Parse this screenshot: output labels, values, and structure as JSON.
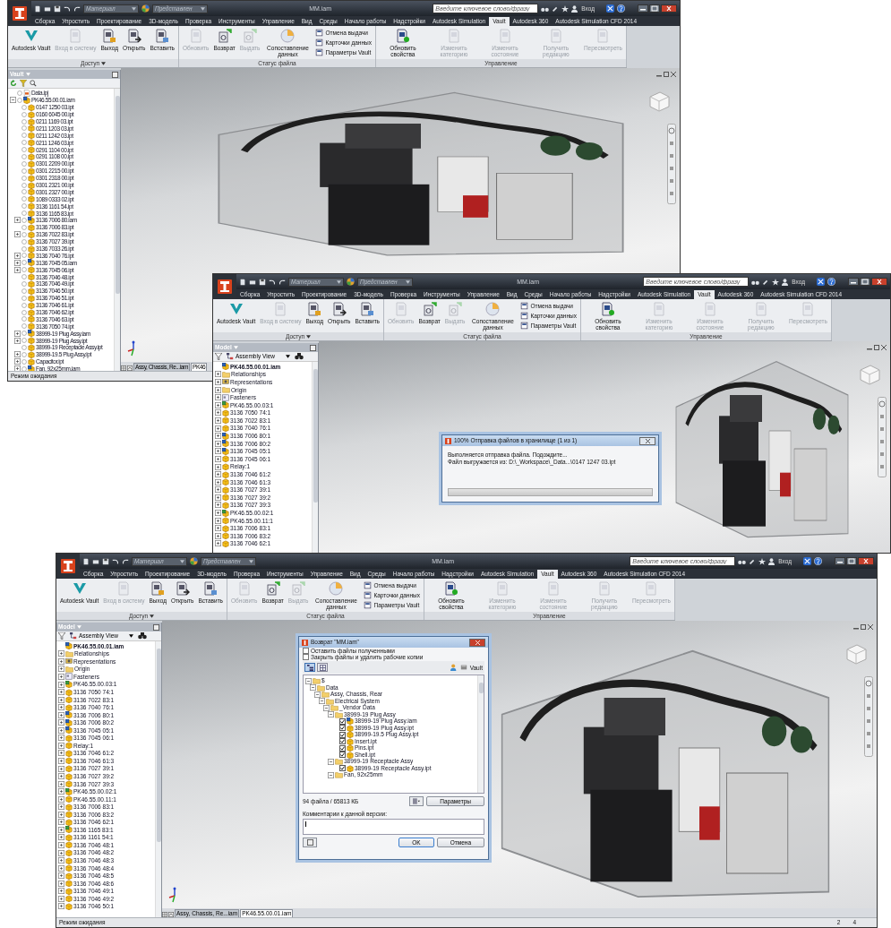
{
  "windows": [
    {
      "title": "MM.iam",
      "material": "Материал",
      "appearance": "Представлен",
      "search": {
        "placeholder": "Введите ключевое слово/фразу"
      },
      "sign_in": "Вход",
      "tabs": [
        {
          "label": "Сборка",
          "selected": false
        },
        {
          "label": "Упростить",
          "selected": false
        },
        {
          "label": "Проектирование",
          "selected": false
        },
        {
          "label": "3D-модель",
          "selected": false
        },
        {
          "label": "Проверка",
          "selected": false
        },
        {
          "label": "Инструменты",
          "selected": false
        },
        {
          "label": "Управление",
          "selected": false
        },
        {
          "label": "Вид",
          "selected": false
        },
        {
          "label": "Среды",
          "selected": false
        },
        {
          "label": "Начало работы",
          "selected": false
        },
        {
          "label": "Надстройки",
          "selected": false
        },
        {
          "label": "Autodesk Simulation",
          "selected": false
        },
        {
          "label": "Vault",
          "selected": true
        },
        {
          "label": "Autodesk 360",
          "selected": false
        },
        {
          "label": "Autodesk Simulation CFD 2014",
          "selected": false
        }
      ],
      "ribbon": [
        {
          "label": "Доступ",
          "buttons": [
            {
              "label": "Autodesk Vault",
              "kind": "large",
              "disabled": false
            },
            {
              "label": "Вход в систему",
              "kind": "large",
              "disabled": true
            },
            {
              "label": "Выход",
              "kind": "large",
              "disabled": false
            },
            {
              "label": "Открыть",
              "kind": "large",
              "disabled": false
            },
            {
              "label": "Вставить",
              "kind": "large",
              "disabled": false
            }
          ]
        },
        {
          "label": "Статус файла",
          "buttons": [
            {
              "label": "Обновить",
              "kind": "large",
              "disabled": true
            },
            {
              "label": "Возврат",
              "kind": "large",
              "disabled": false
            },
            {
              "label": "Выдать",
              "kind": "large",
              "disabled": true
            },
            {
              "label": "Сопоставление данных",
              "kind": "large",
              "disabled": false
            },
            {
              "label": "Отмена выдачи",
              "kind": "small",
              "disabled": false
            },
            {
              "label": "Карточки данных",
              "kind": "small",
              "disabled": false
            },
            {
              "label": "Параметры Vault",
              "kind": "small",
              "disabled": false
            }
          ]
        },
        {
          "label": "Управление",
          "buttons": [
            {
              "label": "Обновить свойства",
              "kind": "large",
              "disabled": false
            },
            {
              "label": "Изменить категорию",
              "kind": "large",
              "disabled": true
            },
            {
              "label": "Изменить состояние",
              "kind": "large",
              "disabled": true
            },
            {
              "label": "Получить редакцию",
              "kind": "large",
              "disabled": true
            },
            {
              "label": "Пересмотреть",
              "kind": "large",
              "disabled": true
            }
          ]
        }
      ],
      "browser": {
        "kind": "vault",
        "title": "Vault",
        "tree": [
          {
            "label": "Data.ipj",
            "kind": "project"
          },
          {
            "label": "PK46.55.00.01.iam",
            "kind": "assembly",
            "expanded": true,
            "children": [
              {
                "label": "0147 1250 03.ipt",
                "kind": "part"
              },
              {
                "label": "0160 6045 00.ipt",
                "kind": "part"
              },
              {
                "label": "0211 1169 03.ipt",
                "kind": "part"
              },
              {
                "label": "0211 1203 03.ipt",
                "kind": "part"
              },
              {
                "label": "0211 1242 03.ipt",
                "kind": "part"
              },
              {
                "label": "0211 1246 03.ipt",
                "kind": "part"
              },
              {
                "label": "0291 1104 00.ipt",
                "kind": "part"
              },
              {
                "label": "0291 1108 00.ipt",
                "kind": "part"
              },
              {
                "label": "0301 2209 00.ipt",
                "kind": "part"
              },
              {
                "label": "0301 2215 00.ipt",
                "kind": "part"
              },
              {
                "label": "0301 2318 00.ipt",
                "kind": "part"
              },
              {
                "label": "0301 2321 00.ipt",
                "kind": "part"
              },
              {
                "label": "0301 2327 00.ipt",
                "kind": "part"
              },
              {
                "label": "1089 0333 02.ipt",
                "kind": "part"
              },
              {
                "label": "3136 1161 54.ipt",
                "kind": "part"
              },
              {
                "label": "3136 1165 83.ipt",
                "kind": "part"
              },
              {
                "label": "3136 7006 80.iam",
                "kind": "assembly",
                "expanded": false
              },
              {
                "label": "3136 7006 83.ipt",
                "kind": "part"
              },
              {
                "label": "3136 7022 83.ipt",
                "kind": "part",
                "expanded": false
              },
              {
                "label": "3136 7027 39.ipt",
                "kind": "part"
              },
              {
                "label": "3136 7033 26.ipt",
                "kind": "part"
              },
              {
                "label": "3136 7040 76.ipt",
                "kind": "part",
                "expanded": false
              },
              {
                "label": "3136 7045 05.iam",
                "kind": "assembly",
                "expanded": false
              },
              {
                "label": "3136 7045 06.ipt",
                "kind": "part",
                "expanded": false
              },
              {
                "label": "3136 7046 48.ipt",
                "kind": "part"
              },
              {
                "label": "3136 7046 49.ipt",
                "kind": "part"
              },
              {
                "label": "3136 7046 50.ipt",
                "kind": "part"
              },
              {
                "label": "3136 7046 51.ipt",
                "kind": "part"
              },
              {
                "label": "3136 7046 61.ipt",
                "kind": "part"
              },
              {
                "label": "3136 7046 62.ipt",
                "kind": "part"
              },
              {
                "label": "3136 7046 63.ipt",
                "kind": "part"
              },
              {
                "label": "3136 7050 74.ipt",
                "kind": "part"
              },
              {
                "label": "38999-19 Plug Assy.iam",
                "kind": "assembly",
                "expanded": false
              },
              {
                "label": "38999-19 Plug Assy.ipt",
                "kind": "part",
                "expanded": false
              },
              {
                "label": "38999-19 Receptacle Assy.ipt",
                "kind": "part"
              },
              {
                "label": "38999-19.5 Plug Assy.ipt",
                "kind": "part",
                "expanded": false
              },
              {
                "label": "Capacitor.ipt",
                "kind": "part",
                "expanded": false
              },
              {
                "label": "Fan, 92x25mm.iam",
                "kind": "assembly",
                "expanded": false
              }
            ]
          }
        ]
      },
      "document_tabs": [
        {
          "label": "Assy, Chassis, Re...iam",
          "selected": false
        },
        {
          "label": "PK46",
          "selected": true
        }
      ],
      "status_bar": {
        "text": "Режим ожидания"
      }
    },
    {
      "title": "MM.iam",
      "material": "Материал",
      "appearance": "Представлен",
      "search": {
        "placeholder": "Введите ключевое слово/фразу"
      },
      "sign_in": "Вход",
      "tabs": [
        {
          "label": "Сборка",
          "selected": false
        },
        {
          "label": "Упростить",
          "selected": false
        },
        {
          "label": "Проектирование",
          "selected": false
        },
        {
          "label": "3D-модель",
          "selected": false
        },
        {
          "label": "Проверка",
          "selected": false
        },
        {
          "label": "Инструменты",
          "selected": false
        },
        {
          "label": "Управление",
          "selected": false
        },
        {
          "label": "Вид",
          "selected": false
        },
        {
          "label": "Среды",
          "selected": false
        },
        {
          "label": "Начало работы",
          "selected": false
        },
        {
          "label": "Надстройки",
          "selected": false
        },
        {
          "label": "Autodesk Simulation",
          "selected": false
        },
        {
          "label": "Vault",
          "selected": true
        },
        {
          "label": "Autodesk 360",
          "selected": false
        },
        {
          "label": "Autodesk Simulation CFD 2014",
          "selected": false
        }
      ],
      "ribbon": [
        {
          "label": "Доступ",
          "buttons": [
            {
              "label": "Autodesk Vault",
              "kind": "large",
              "disabled": false
            },
            {
              "label": "Вход в систему",
              "kind": "large",
              "disabled": true
            },
            {
              "label": "Выход",
              "kind": "large",
              "disabled": false
            },
            {
              "label": "Открыть",
              "kind": "large",
              "disabled": false
            },
            {
              "label": "Вставить",
              "kind": "large",
              "disabled": false
            }
          ]
        },
        {
          "label": "Статус файла",
          "buttons": [
            {
              "label": "Обновить",
              "kind": "large",
              "disabled": true
            },
            {
              "label": "Возврат",
              "kind": "large",
              "disabled": false
            },
            {
              "label": "Выдать",
              "kind": "large",
              "disabled": true
            },
            {
              "label": "Сопоставление данных",
              "kind": "large",
              "disabled": false
            },
            {
              "label": "Отмена выдачи",
              "kind": "small",
              "disabled": false
            },
            {
              "label": "Карточки данных",
              "kind": "small",
              "disabled": false
            },
            {
              "label": "Параметры Vault",
              "kind": "small",
              "disabled": false
            }
          ]
        },
        {
          "label": "Управление",
          "buttons": [
            {
              "label": "Обновить свойства",
              "kind": "large",
              "disabled": false
            },
            {
              "label": "Изменить категорию",
              "kind": "large",
              "disabled": true
            },
            {
              "label": "Изменить состояние",
              "kind": "large",
              "disabled": true
            },
            {
              "label": "Получить редакцию",
              "kind": "large",
              "disabled": true
            },
            {
              "label": "Пересмотреть",
              "kind": "large",
              "disabled": true
            }
          ]
        }
      ],
      "browser": {
        "kind": "model",
        "title": "Model",
        "view": "Assembly View",
        "tree": [
          {
            "label": "PK46.55.00.01.iam",
            "kind": "assembly",
            "children": [
              {
                "label": "Relationships",
                "kind": "folder",
                "expanded": false
              },
              {
                "label": "Representations",
                "kind": "representations",
                "expanded": false
              },
              {
                "label": "Origin",
                "kind": "folder",
                "expanded": false
              },
              {
                "label": "Fasteners",
                "kind": "fasteners",
                "expanded": false
              },
              {
                "label": "PK46.55.00.03:1",
                "kind": "subassembly",
                "expanded": false
              },
              {
                "label": "3136 7050 74:1",
                "kind": "part",
                "expanded": false
              },
              {
                "label": "3136 7022 83:1",
                "kind": "part",
                "expanded": false
              },
              {
                "label": "3136 7040 76:1",
                "kind": "part",
                "expanded": false
              },
              {
                "label": "3136 7006 80:1",
                "kind": "assembly",
                "expanded": false
              },
              {
                "label": "3136 7006 80:2",
                "kind": "assembly",
                "expanded": false
              },
              {
                "label": "3136 7045 05:1",
                "kind": "assembly",
                "expanded": false
              },
              {
                "label": "3136 7045 06:1",
                "kind": "part",
                "expanded": false
              },
              {
                "label": "Relay:1",
                "kind": "part",
                "expanded": false
              },
              {
                "label": "3136 7046 61:2",
                "kind": "part",
                "expanded": false
              },
              {
                "label": "3136 7046 61:3",
                "kind": "part",
                "expanded": false
              },
              {
                "label": "3136 7027 39:1",
                "kind": "part",
                "expanded": false
              },
              {
                "label": "3136 7027 39:2",
                "kind": "part",
                "expanded": false
              },
              {
                "label": "3136 7027 39:3",
                "kind": "part",
                "expanded": false
              },
              {
                "label": "PK46.55.00.02:1",
                "kind": "subassembly",
                "expanded": false
              },
              {
                "label": "PK46.55.00.11:1",
                "kind": "part",
                "expanded": false
              },
              {
                "label": "3136 7006 83:1",
                "kind": "part",
                "expanded": false
              },
              {
                "label": "3136 7006 83:2",
                "kind": "part",
                "expanded": false
              },
              {
                "label": "3136 7046 62:1",
                "kind": "part",
                "expanded": false
              }
            ]
          }
        ]
      },
      "dialog": {
        "kind": "progress",
        "title": "100% Отправка файлов в хранилище (1 из 1)",
        "lines": [
          "Выполняется отправка файла. Подождите...",
          "Файл выгружается из: D:\\_Workspace\\_Data...\\0147 1247 03.ipt"
        ],
        "progress": {
          "level": 1
        }
      }
    },
    {
      "title": "MM.iam",
      "material": "Материал",
      "appearance": "Представлен",
      "search": {
        "placeholder": "Введите ключевое слово/фразу"
      },
      "sign_in": "Вход",
      "tabs": [
        {
          "label": "Сборка",
          "selected": false
        },
        {
          "label": "Упростить",
          "selected": false
        },
        {
          "label": "Проектирование",
          "selected": false
        },
        {
          "label": "3D-модель",
          "selected": false
        },
        {
          "label": "Проверка",
          "selected": false
        },
        {
          "label": "Инструменты",
          "selected": false
        },
        {
          "label": "Управление",
          "selected": false
        },
        {
          "label": "Вид",
          "selected": false
        },
        {
          "label": "Среды",
          "selected": false
        },
        {
          "label": "Начало работы",
          "selected": false
        },
        {
          "label": "Надстройки",
          "selected": false
        },
        {
          "label": "Autodesk Simulation",
          "selected": false
        },
        {
          "label": "Vault",
          "selected": true
        },
        {
          "label": "Autodesk 360",
          "selected": false
        },
        {
          "label": "Autodesk Simulation CFD 2014",
          "selected": false
        }
      ],
      "ribbon": [
        {
          "label": "Доступ",
          "buttons": [
            {
              "label": "Autodesk Vault",
              "kind": "large",
              "disabled": false
            },
            {
              "label": "Вход в систему",
              "kind": "large",
              "disabled": true
            },
            {
              "label": "Выход",
              "kind": "large",
              "disabled": false
            },
            {
              "label": "Открыть",
              "kind": "large",
              "disabled": false
            },
            {
              "label": "Вставить",
              "kind": "large",
              "disabled": false
            }
          ]
        },
        {
          "label": "Статус файла",
          "buttons": [
            {
              "label": "Обновить",
              "kind": "large",
              "disabled": true
            },
            {
              "label": "Возврат",
              "kind": "large",
              "disabled": false
            },
            {
              "label": "Выдать",
              "kind": "large",
              "disabled": true
            },
            {
              "label": "Сопоставление данных",
              "kind": "large",
              "disabled": false
            },
            {
              "label": "Отмена выдачи",
              "kind": "small",
              "disabled": false
            },
            {
              "label": "Карточки данных",
              "kind": "small",
              "disabled": false
            },
            {
              "label": "Параметры Vault",
              "kind": "small",
              "disabled": false
            }
          ]
        },
        {
          "label": "Управление",
          "buttons": [
            {
              "label": "Обновить свойства",
              "kind": "large",
              "disabled": false
            },
            {
              "label": "Изменить категорию",
              "kind": "large",
              "disabled": true
            },
            {
              "label": "Изменить состояние",
              "kind": "large",
              "disabled": true
            },
            {
              "label": "Получить редакцию",
              "kind": "large",
              "disabled": true
            },
            {
              "label": "Пересмотреть",
              "kind": "large",
              "disabled": true
            }
          ]
        }
      ],
      "browser": {
        "kind": "model",
        "title": "Model",
        "view": "Assembly View",
        "tree": [
          {
            "label": "PK46.55.00.01.iam",
            "kind": "assembly",
            "children": [
              {
                "label": "Relationships",
                "kind": "folder",
                "expanded": false
              },
              {
                "label": "Representations",
                "kind": "representations",
                "expanded": false
              },
              {
                "label": "Origin",
                "kind": "folder",
                "expanded": false
              },
              {
                "label": "Fasteners",
                "kind": "fasteners",
                "expanded": false
              },
              {
                "label": "PK46.55.00.03:1",
                "kind": "subassembly",
                "expanded": false
              },
              {
                "label": "3136 7050 74:1",
                "kind": "part",
                "expanded": false
              },
              {
                "label": "3136 7022 83:1",
                "kind": "part",
                "expanded": false
              },
              {
                "label": "3136 7040 76:1",
                "kind": "part",
                "expanded": false
              },
              {
                "label": "3136 7006 80:1",
                "kind": "assembly",
                "expanded": false
              },
              {
                "label": "3136 7006 80:2",
                "kind": "assembly",
                "expanded": false
              },
              {
                "label": "3136 7045 05:1",
                "kind": "assembly",
                "expanded": false
              },
              {
                "label": "3136 7045 06:1",
                "kind": "part",
                "expanded": false
              },
              {
                "label": "Relay:1",
                "kind": "part",
                "expanded": false
              },
              {
                "label": "3136 7046 61:2",
                "kind": "part",
                "expanded": false
              },
              {
                "label": "3136 7046 61:3",
                "kind": "part",
                "expanded": false
              },
              {
                "label": "3136 7027 39:1",
                "kind": "part",
                "expanded": false
              },
              {
                "label": "3136 7027 39:2",
                "kind": "part",
                "expanded": false
              },
              {
                "label": "3136 7027 39:3",
                "kind": "part",
                "expanded": false
              },
              {
                "label": "PK46.55.00.02:1",
                "kind": "subassembly",
                "expanded": false
              },
              {
                "label": "PK46.55.00.11:1",
                "kind": "part",
                "expanded": false
              },
              {
                "label": "3136 7006 83:1",
                "kind": "part",
                "expanded": false
              },
              {
                "label": "3136 7006 83:2",
                "kind": "part",
                "expanded": false
              },
              {
                "label": "3136 7046 62:1",
                "kind": "part",
                "expanded": false
              },
              {
                "label": "3136 1165 83:1",
                "kind": "subassembly",
                "expanded": false
              },
              {
                "label": "3136 1161 54:1",
                "kind": "part",
                "expanded": false
              },
              {
                "label": "3136 7046 48:1",
                "kind": "part",
                "expanded": false
              },
              {
                "label": "3136 7046 48:2",
                "kind": "part",
                "expanded": false
              },
              {
                "label": "3136 7046 48:3",
                "kind": "part",
                "expanded": false
              },
              {
                "label": "3136 7046 48:4",
                "kind": "part",
                "expanded": false
              },
              {
                "label": "3136 7046 48:5",
                "kind": "part",
                "expanded": false
              },
              {
                "label": "3136 7046 48:6",
                "kind": "part",
                "expanded": false
              },
              {
                "label": "3136 7046 49:1",
                "kind": "part",
                "expanded": false
              },
              {
                "label": "3136 7046 49:2",
                "kind": "part",
                "expanded": false
              },
              {
                "label": "3136 7046 50:1",
                "kind": "part",
                "expanded": false
              }
            ]
          }
        ]
      },
      "dialog": {
        "kind": "checkin",
        "title": "Возврат \"MM.iam\"",
        "options": [
          {
            "label": "Оставить файлы полученными",
            "checked": false
          },
          {
            "label": "Закрыть файлы и удалить рабочие копии",
            "checked": false
          }
        ],
        "view_toggles": [
          {
            "selected": true
          },
          {
            "selected": false
          }
        ],
        "vault_label": "Vault",
        "tree": [
          {
            "label": "$",
            "kind": "folder",
            "expanded": true,
            "children": [
              {
                "label": "Data",
                "kind": "folder",
                "expanded": true,
                "children": [
                  {
                    "label": "Assy, Chassis, Rear",
                    "kind": "folder",
                    "expanded": true,
                    "children": [
                      {
                        "label": "Electrical System",
                        "kind": "folder",
                        "expanded": true,
                        "children": [
                          {
                            "label": "_Vendor Data",
                            "kind": "folder",
                            "expanded": true,
                            "children": [
                              {
                                "label": "38999-19 Plug Assy",
                                "kind": "folder",
                                "expanded": true,
                                "children": [
                                  {
                                    "label": "38999-19 Plug Assy.iam",
                                    "kind": "assembly",
                                    "checked": true
                                  },
                                  {
                                    "label": "38999-19 Plug Assy.ipt",
                                    "kind": "part",
                                    "checked": true
                                  },
                                  {
                                    "label": "38999-19.5 Plug Assy.ipt",
                                    "kind": "part",
                                    "checked": true
                                  },
                                  {
                                    "label": "Insert.ipt",
                                    "kind": "part",
                                    "checked": true
                                  },
                                  {
                                    "label": "Pins.ipt",
                                    "kind": "part",
                                    "checked": true
                                  },
                                  {
                                    "label": "Shell.ipt",
                                    "kind": "part",
                                    "checked": true
                                  }
                                ]
                              },
                              {
                                "label": "38999-19 Receptacle Assy",
                                "kind": "folder",
                                "expanded": true,
                                "children": [
                                  {
                                    "label": "38999-19 Receptacle Assy.ipt",
                                    "kind": "part",
                                    "checked": true
                                  }
                                ]
                              },
                              {
                                "label": "Fan, 92x25mm",
                                "kind": "folder",
                                "expanded": true
                              }
                            ]
                          }
                        ]
                      }
                    ]
                  }
                ]
              }
            ]
          }
        ],
        "summary": "94 файла / 65813 КБ",
        "settings_button": "Параметры",
        "comment_label": "Комментарии к данной версии:",
        "buttons": [
          "OK",
          "Отмена"
        ]
      },
      "document_tabs": [
        {
          "label": "Assy, Chassis, Re...iam",
          "selected": false
        },
        {
          "label": "PK46.55.00.01.iam",
          "selected": true
        }
      ],
      "status_bar": {
        "text": "Режим ожидания",
        "counters": [
          "2",
          "4"
        ]
      }
    }
  ]
}
